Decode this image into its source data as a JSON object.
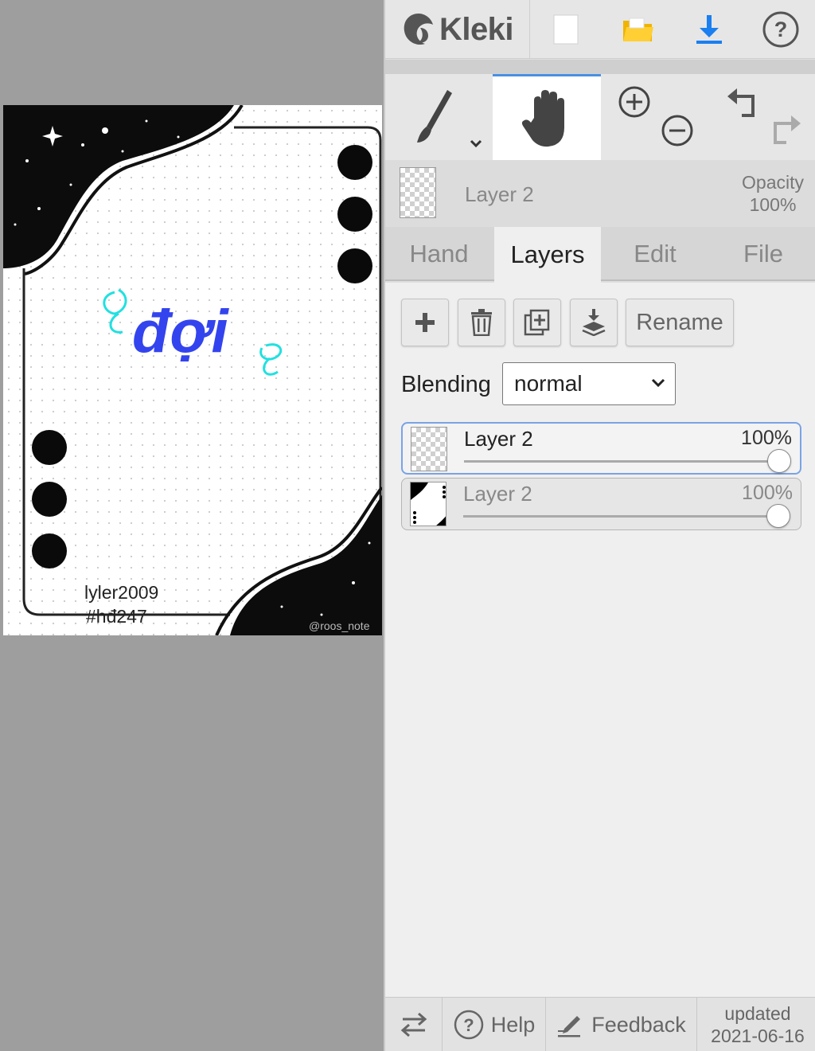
{
  "app": {
    "name": "Kleki"
  },
  "toolbar": {
    "new_icon": "new-file-icon",
    "open_icon": "folder-icon",
    "save_icon": "download-icon",
    "help_icon": "help-icon"
  },
  "tools": {
    "brush_icon": "brush-icon",
    "hand_icon": "hand-icon",
    "zoom_in_icon": "zoom-in-icon",
    "zoom_out_icon": "zoom-out-icon",
    "undo_icon": "undo-icon",
    "redo_icon": "redo-icon"
  },
  "current_layer": {
    "name": "Layer 2",
    "opacity_label": "Opacity",
    "opacity_value": "100%"
  },
  "tabs": [
    {
      "label": "Hand"
    },
    {
      "label": "Layers"
    },
    {
      "label": "Edit"
    },
    {
      "label": "File"
    }
  ],
  "layers_panel": {
    "rename_label": "Rename",
    "blending_label": "Blending",
    "blending_value": "normal",
    "layers": [
      {
        "name": "Layer 2",
        "opacity": "100%",
        "opacity_fraction": 1.0,
        "selected": true
      },
      {
        "name": "Layer 2",
        "opacity": "100%",
        "opacity_fraction": 1.0,
        "selected": false
      }
    ]
  },
  "bottombar": {
    "help_label": "Help",
    "feedback_label": "Feedback",
    "updated_label": "updated",
    "updated_date": "2021-06-16"
  },
  "artwork": {
    "title_text": "đợi",
    "signature_line1": "lyler2009",
    "signature_line2": "#hđ247",
    "watermark": "@roos_note",
    "colors": {
      "ink": "#111111",
      "title_blue": "#3344ee",
      "accent_cyan": "#22e0e0"
    }
  }
}
